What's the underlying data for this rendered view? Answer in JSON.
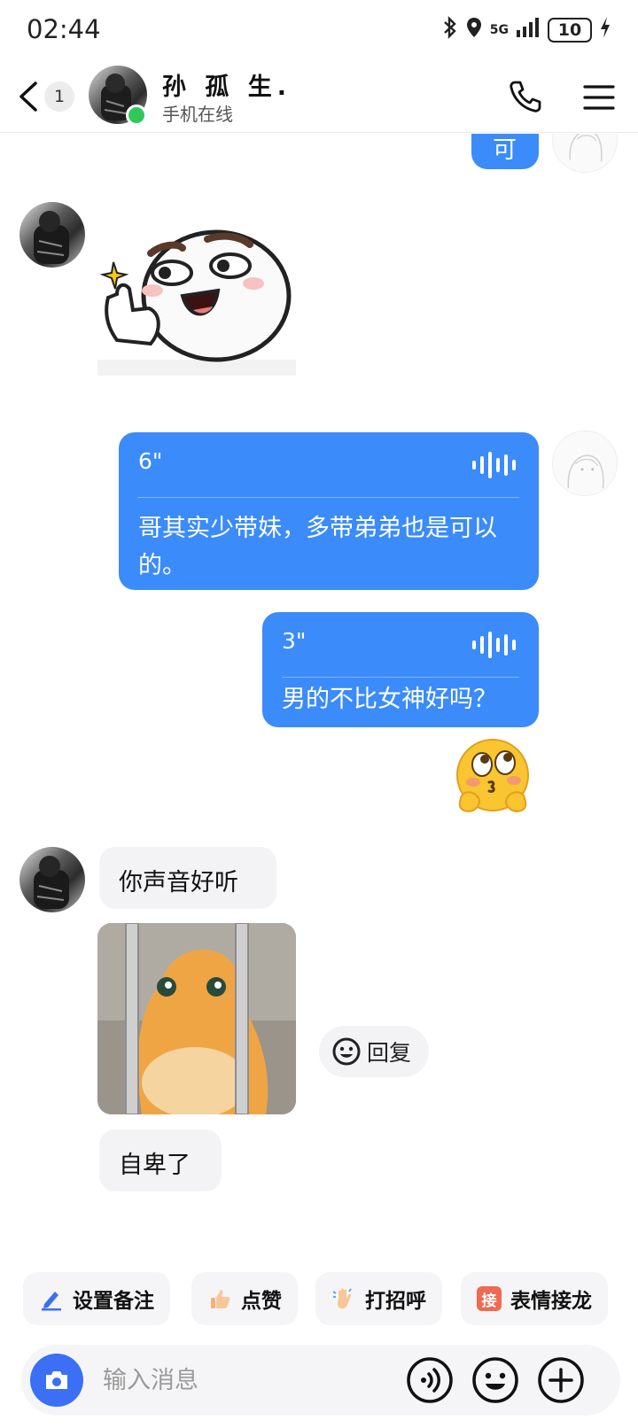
{
  "status_bar": {
    "time": "02:44",
    "network": "5G",
    "battery": "10"
  },
  "header": {
    "unread_count": "1",
    "contact_name": "孙 孤 生.",
    "contact_status": "手机在线"
  },
  "messages": {
    "partial_top": "可",
    "voice_1": {
      "duration": "6\"",
      "transcript": "哥其实少带妹，多带弟弟也是可以的。"
    },
    "voice_2": {
      "duration": "3\"",
      "transcript": "男的不比女神好吗？"
    },
    "text_1": "你声音好听",
    "text_2": "自卑了"
  },
  "reply_chip": {
    "label": "回复"
  },
  "quick_actions": [
    {
      "label": "设置备注",
      "icon": "pen-icon"
    },
    {
      "label": "点赞",
      "icon": "thumbs-up-icon"
    },
    {
      "label": "打招呼",
      "icon": "wave-hand-icon"
    },
    {
      "label": "表情接龙",
      "icon": "jie-badge-icon",
      "icon_text": "接"
    }
  ],
  "input": {
    "placeholder": "输入消息"
  },
  "colors": {
    "bubble_out": "#3b8bfa",
    "bubble_in": "#f3f3f5",
    "online": "#2fc95a",
    "camera": "#3b6ff5"
  }
}
